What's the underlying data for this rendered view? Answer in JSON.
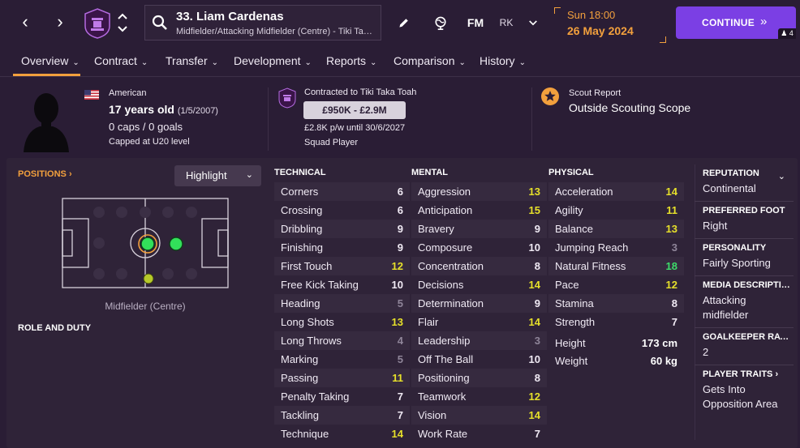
{
  "header": {
    "player_title": "33. Liam Cardenas",
    "player_subtitle": "Midfielder/Attacking Midfielder (Centre) - Tiki Taka Toah",
    "fm_label": "FM",
    "rk_label": "RK",
    "date_time": "Sun 18:00",
    "date_day": "26 May 2024",
    "continue_label": "CONTINUE",
    "continue_count": "4",
    "icons": [
      "chevron-left-icon",
      "chevron-right-icon",
      "club-badge-icon",
      "up-down-icon",
      "search-icon",
      "edit-icon",
      "globe-icon",
      "chevron-down-icon",
      "double-chevron-right-icon",
      "person-icon"
    ]
  },
  "tabs": [
    {
      "label": "Overview"
    },
    {
      "label": "Contract"
    },
    {
      "label": "Transfer"
    },
    {
      "label": "Development"
    },
    {
      "label": "Reports"
    },
    {
      "label": "Comparison"
    },
    {
      "label": "History"
    }
  ],
  "info": {
    "nationality": "American",
    "age": "17 years old",
    "dob": "(1/5/2007)",
    "caps": "0 caps / 0 goals",
    "capped": "Capped at U20 level",
    "contracted": "Contracted to Tiki Taka Toah",
    "value": "£950K - £2.9M",
    "wage": "£2.8K p/w until 30/6/2027",
    "squad_status": "Squad Player",
    "scout_title": "Scout Report",
    "scout_value": "Outside Scouting Scope"
  },
  "positions": {
    "link": "POSITIONS",
    "highlight": "Highlight",
    "caption": "Midfielder (Centre)",
    "role_duty": "ROLE AND DUTY"
  },
  "attributes": {
    "technical_title": "TECHNICAL",
    "mental_title": "MENTAL",
    "physical_title": "PHYSICAL",
    "technical": [
      {
        "name": "Corners",
        "value": "6"
      },
      {
        "name": "Crossing",
        "value": "6"
      },
      {
        "name": "Dribbling",
        "value": "9"
      },
      {
        "name": "Finishing",
        "value": "9"
      },
      {
        "name": "First Touch",
        "value": "12"
      },
      {
        "name": "Free Kick Taking",
        "value": "10"
      },
      {
        "name": "Heading",
        "value": "5"
      },
      {
        "name": "Long Shots",
        "value": "13"
      },
      {
        "name": "Long Throws",
        "value": "4"
      },
      {
        "name": "Marking",
        "value": "5"
      },
      {
        "name": "Passing",
        "value": "11"
      },
      {
        "name": "Penalty Taking",
        "value": "7"
      },
      {
        "name": "Tackling",
        "value": "7"
      },
      {
        "name": "Technique",
        "value": "14"
      }
    ],
    "mental": [
      {
        "name": "Aggression",
        "value": "13"
      },
      {
        "name": "Anticipation",
        "value": "15"
      },
      {
        "name": "Bravery",
        "value": "9"
      },
      {
        "name": "Composure",
        "value": "10"
      },
      {
        "name": "Concentration",
        "value": "8"
      },
      {
        "name": "Decisions",
        "value": "14"
      },
      {
        "name": "Determination",
        "value": "9"
      },
      {
        "name": "Flair",
        "value": "14"
      },
      {
        "name": "Leadership",
        "value": "3"
      },
      {
        "name": "Off The Ball",
        "value": "10"
      },
      {
        "name": "Positioning",
        "value": "8"
      },
      {
        "name": "Teamwork",
        "value": "12"
      },
      {
        "name": "Vision",
        "value": "14"
      },
      {
        "name": "Work Rate",
        "value": "7"
      }
    ],
    "physical": [
      {
        "name": "Acceleration",
        "value": "14"
      },
      {
        "name": "Agility",
        "value": "11"
      },
      {
        "name": "Balance",
        "value": "13"
      },
      {
        "name": "Jumping Reach",
        "value": "3"
      },
      {
        "name": "Natural Fitness",
        "value": "18"
      },
      {
        "name": "Pace",
        "value": "12"
      },
      {
        "name": "Stamina",
        "value": "8"
      },
      {
        "name": "Strength",
        "value": "7"
      }
    ],
    "height_label": "Height",
    "height_value": "173 cm",
    "weight_label": "Weight",
    "weight_value": "60 kg"
  },
  "side": {
    "reputation_title": "REPUTATION",
    "reputation_value": "Continental",
    "preferred_title": "PREFERRED FOOT",
    "preferred_value": "Right",
    "personality_title": "PERSONALITY",
    "personality_value": "Fairly Sporting",
    "media_title": "MEDIA DESCRIPTION",
    "media_value": "Attacking midfielder",
    "gk_title": "GOALKEEPER RATING",
    "gk_value": "2",
    "traits_title": "PLAYER TRAITS",
    "traits_value": "Gets Into Opposition Area"
  },
  "colors": {
    "background": "#2a1d35",
    "accent": "#f2a03d",
    "continue": "#7b3fe4",
    "attr_yellow": "#e6e02a",
    "attr_green": "#3ddb6a",
    "attr_grey": "#8f8599"
  }
}
